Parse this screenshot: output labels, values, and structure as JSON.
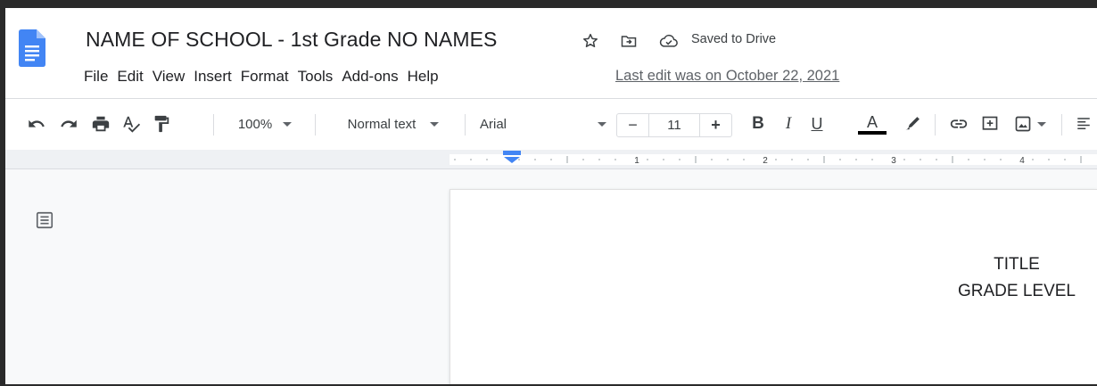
{
  "app": {
    "document_title": "NAME OF SCHOOL - 1st Grade NO NAMES",
    "save_status": "Saved to Drive",
    "last_edit": "Last edit was on October 22, 2021",
    "icons": [
      "docs-logo-icon",
      "star-icon",
      "move-to-folder-icon",
      "cloud-saved-icon"
    ],
    "brand_color": "#4285f4"
  },
  "menu": {
    "items": [
      "File",
      "Edit",
      "View",
      "Insert",
      "Format",
      "Tools",
      "Add-ons",
      "Help"
    ]
  },
  "toolbar": {
    "zoom": "100%",
    "style": "Normal text",
    "font": "Arial",
    "font_size": "11",
    "decrease_label": "−",
    "increase_label": "+",
    "bold_label": "B",
    "italic_label": "I",
    "underline_label": "U",
    "text_color_label": "A",
    "text_color": "#000000",
    "icons": [
      "undo-icon",
      "redo-icon",
      "print-icon",
      "spellcheck-icon",
      "paint-format-icon",
      "highlight-icon",
      "link-icon",
      "comment-icon",
      "image-icon",
      "align-icon"
    ]
  },
  "ruler": {
    "labels": [
      "1",
      "2",
      "3",
      "4"
    ]
  },
  "document": {
    "lines": [
      "TITLE",
      "GRADE LEVEL"
    ]
  }
}
